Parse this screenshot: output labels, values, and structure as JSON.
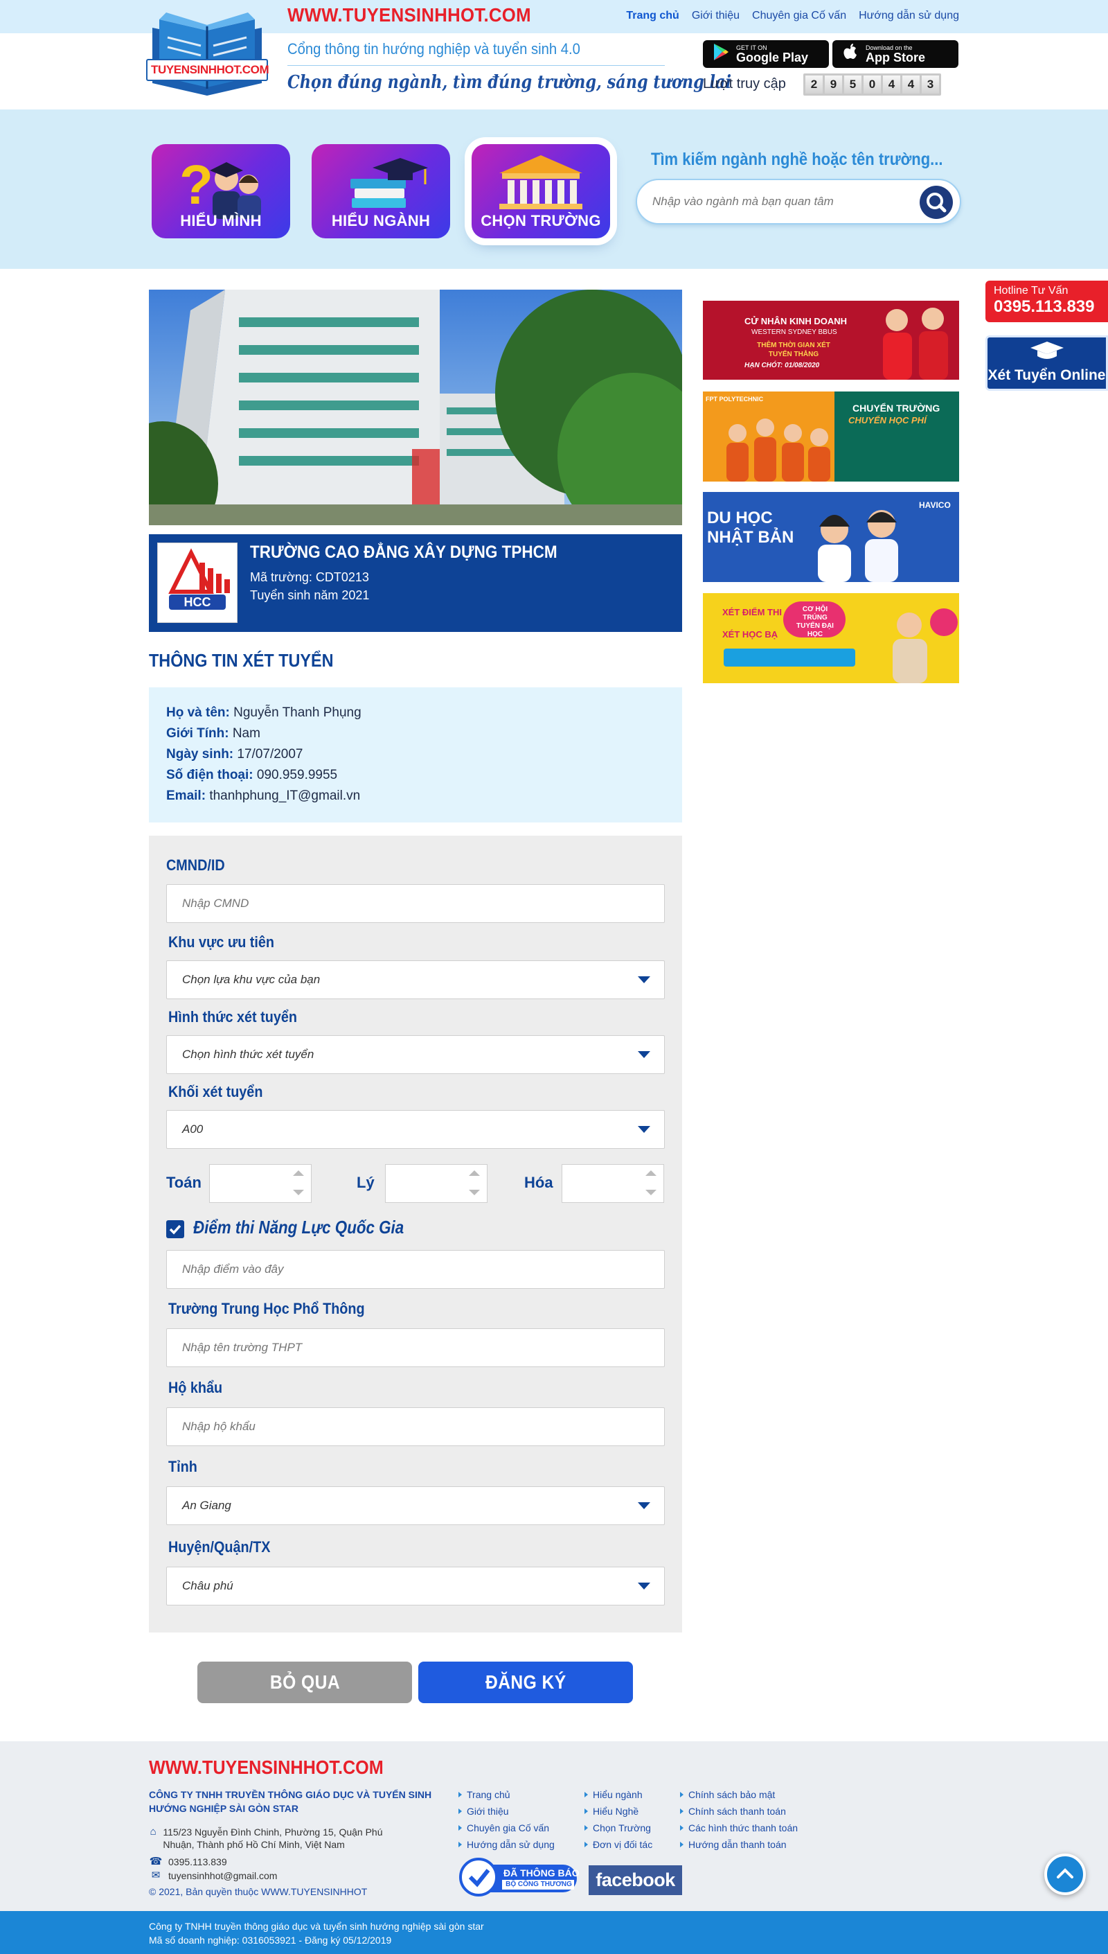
{
  "header": {
    "site_url": "WWW.TUYENSINHHOT.COM",
    "logo_text": "TUYENSINHHOT.COM",
    "nav": [
      {
        "label": "Trang chủ",
        "active": true
      },
      {
        "label": "Giới thiệu",
        "active": false
      },
      {
        "label": "Chuyên gia Cố vấn",
        "active": false
      },
      {
        "label": "Hướng dẫn sử dụng",
        "active": false
      }
    ],
    "tagline": "Cổng thông tin hướng nghiệp và tuyển sinh 4.0",
    "slogan": "Chọn đúng ngành, tìm đúng trường, sáng tương lai",
    "google_play": {
      "small": "GET IT ON",
      "big": "Google Play"
    },
    "app_store": {
      "small": "Download on the",
      "big": "App Store"
    },
    "visits_label": "Lượt truy cập",
    "visit_digits": [
      "2",
      "9",
      "5",
      "0",
      "4",
      "4",
      "3"
    ]
  },
  "hero": {
    "tiles": [
      {
        "label": "HIỂU MÌNH",
        "icon": "students-question-icon",
        "selected": false
      },
      {
        "label": "HIỂU NGÀNH",
        "icon": "books-graduation-cap-icon",
        "selected": false
      },
      {
        "label": "CHỌN TRƯỜNG",
        "icon": "school-building-icon",
        "selected": true
      }
    ],
    "search_title": "Tìm kiếm ngành nghề hoặc tên trường...",
    "search_placeholder": "Nhập vào ngành mà bạn quan tâm"
  },
  "side": {
    "hotline_label": "Hotline Tư Vấn",
    "hotline_number": "0395.113.839",
    "online_label": "Xét Tuyển Online"
  },
  "school": {
    "name": "TRƯỜNG CAO ĐẲNG XÂY DỰNG TPHCM",
    "code": "Mã trường: CDT0213",
    "year": "Tuyển sinh năm 2021",
    "logo_text": "HCC"
  },
  "section_title": "THÔNG TIN XÉT TUYỂN",
  "applicant": [
    {
      "label": "Họ và tên:",
      "value": "Nguyễn Thanh Phụng"
    },
    {
      "label": "Giới Tính:",
      "value": "Nam"
    },
    {
      "label": "Ngày sinh:",
      "value": "17/07/2007"
    },
    {
      "label": "Số điện thoại:",
      "value": "090.959.9955"
    },
    {
      "label": "Email:",
      "value": "thanhphung_IT@gmail.vn"
    }
  ],
  "form": {
    "cmnd": {
      "label": "CMND/ID",
      "placeholder": "Nhập CMND"
    },
    "khuvuc": {
      "label": "Khu vực ưu tiên",
      "value": "Chọn lựa khu vực của bạn"
    },
    "hinhthuc": {
      "label": "Hình thức xét tuyển",
      "value": "Chọn hình thức xét tuyển"
    },
    "khoi": {
      "label": "Khối xét tuyển",
      "value": "A00"
    },
    "subjects": [
      "Toán",
      "Lý",
      "Hóa"
    ],
    "nangluc": {
      "label": "Điểm thi Năng Lực Quốc Gia",
      "checked": true,
      "placeholder": "Nhập điểm vào đây"
    },
    "thpt": {
      "label": "Trường Trung Học Phổ Thông",
      "placeholder": "Nhập tên trường THPT"
    },
    "hokhau": {
      "label": "Hộ khẩu",
      "placeholder": "Nhập hộ khẩu"
    },
    "tinh": {
      "label": "Tỉnh",
      "value": "An Giang"
    },
    "huyen": {
      "label": "Huyện/Quận/TX",
      "value": "Châu phú"
    },
    "cancel_label": "BỎ QUA",
    "submit_label": "ĐĂNG KÝ"
  },
  "banners": [
    {
      "headline": "CỬ NHÂN KINH DOANH",
      "sub": "WESTERN SYDNEY BBUS",
      "line": "THÊM THỜI GIAN XÉT TUYỂN THẲNG",
      "deadline": "HẠN CHÓT: 01/08/2020",
      "color": "#b5122b"
    },
    {
      "headline": "CHUYỂN TRƯỜNG",
      "sub": "CHUYỂN HỌC PHÍ",
      "line": "FPT POLYTECHNIC",
      "color": "#f39a1c"
    },
    {
      "headline": "DU HỌC",
      "sub": "NHẬT BẢN",
      "line": "HAVICO",
      "color": "#2459b8"
    },
    {
      "headline": "XÉT ĐIỂM THI",
      "sub": "XÉT HỌC BẠ",
      "line": "CƠ HỘI TRÚNG TUYỂN ĐẠI HỌC",
      "color": "#f6d21c"
    }
  ],
  "footer": {
    "url": "WWW.TUYENSINHHOT.COM",
    "company": "CÔNG TY TNHH TRUYỀN THÔNG GIÁO DỤC VÀ TUYỂN SINH HƯỚNG NGHIỆP SÀI GÒN STAR",
    "address": "115/23 Nguyễn Đình Chinh, Phường 15, Quận Phú Nhuận, Thành phố Hồ Chí Minh, Việt Nam",
    "phone": "0395.113.839",
    "email": "tuyensinhhot@gmail.com",
    "copyright": "© 2021, Bản quyền thuộc WWW.TUYENSINHHOT",
    "col1": [
      "Trang chủ",
      "Giới thiệu",
      "Chuyên gia Cố vấn",
      "Hướng dẫn sử dụng"
    ],
    "col2": [
      "Hiểu ngành",
      "Hiểu Nghề",
      "Chọn Trường",
      "Đơn vị đối tác"
    ],
    "col3": [
      "Chính sách bảo mật",
      "Chính sách thanh toán",
      "Các hình thức thanh toán",
      "Hướng dẫn thanh toán"
    ],
    "bct_text": "ĐÃ THÔNG BÁO",
    "bct_sub": "BỘ CÔNG THƯƠNG",
    "facebook": "facebook",
    "bottom1": "Công ty TNHH truyền thông giáo dục và tuyển sinh hướng nghiệp sài gòn star",
    "bottom2": "Mã số doanh nghiệp: 0316053921 - Đăng ký 05/12/2019"
  }
}
